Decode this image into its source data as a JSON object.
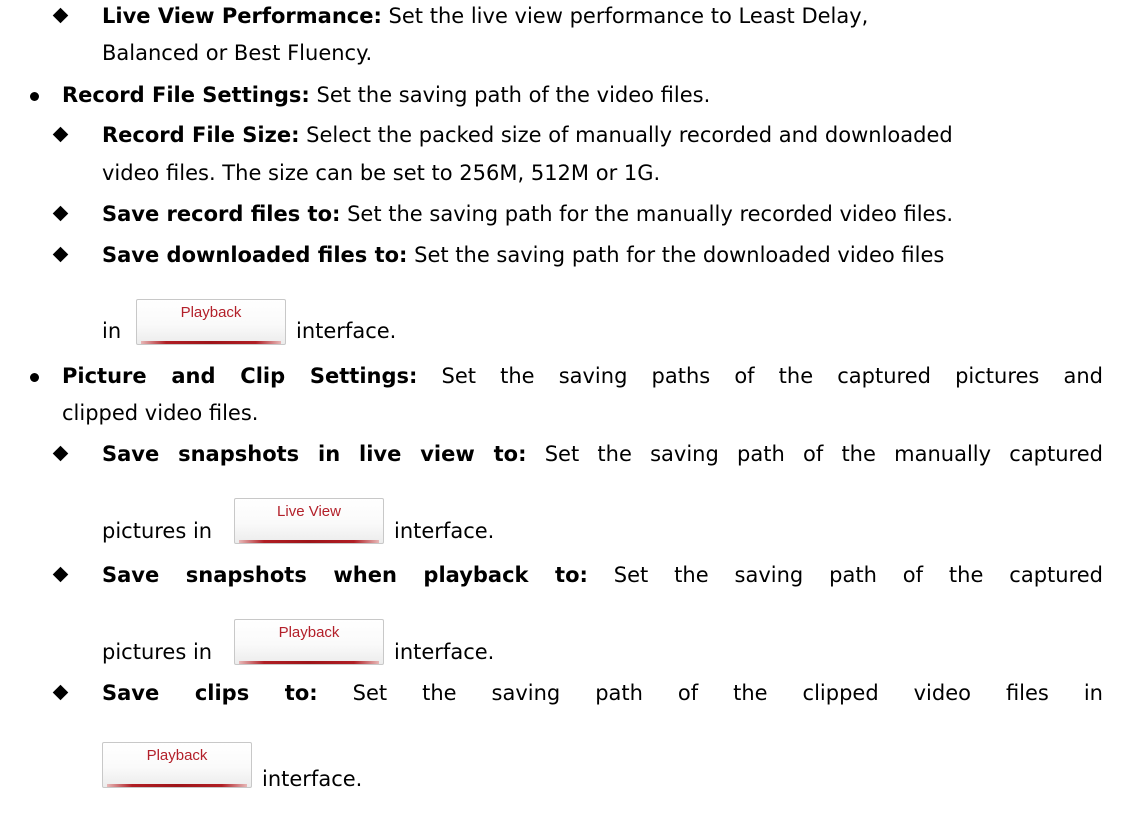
{
  "items": {
    "live_view_performance": {
      "label": "Live View Performance:",
      "text_1": " Set the live view performance to Least Delay,",
      "text_2": "Balanced or Best Fluency."
    },
    "record_file_settings": {
      "label": "Record File Settings:",
      "text": " Set the saving path of the video files."
    },
    "record_file_size": {
      "label": "Record File Size:",
      "text_1": " Select the packed size of manually recorded and downloaded",
      "text_2": "video files. The size can be set to 256M, 512M or 1G."
    },
    "save_record_files": {
      "label": "Save record files to:",
      "text": " Set the saving path for the manually recorded video files."
    },
    "save_downloaded_files": {
      "label": "Save downloaded files to:",
      "text_1": " Set the saving path for the downloaded video files",
      "prefix": "in",
      "suffix": "interface."
    },
    "picture_clip_settings": {
      "label": "Picture and Clip Settings:",
      "text_1": " Set the saving paths of the captured pictures and",
      "text_2": "clipped video files."
    },
    "save_snapshots_live": {
      "label": "Save snapshots in live view to:",
      "text_1": " Set the saving path of the manually captured",
      "prefix": "pictures in",
      "suffix": "interface."
    },
    "save_snapshots_playback": {
      "label": "Save snapshots when playback to:",
      "text_1": " Set the saving path of the captured",
      "prefix": "pictures in",
      "suffix": "interface."
    },
    "save_clips": {
      "label": "Save clips to:",
      "text_1": " Set the saving path of the clipped video files in",
      "suffix": "interface."
    }
  },
  "buttons": {
    "playback": "Playback",
    "live_view": "Live View"
  },
  "colors": {
    "button_text": "#b3202a",
    "button_bar": "#9e1419"
  },
  "icons": {
    "bullet": "filled-circle",
    "sub_bullet": "filled-diamond"
  }
}
